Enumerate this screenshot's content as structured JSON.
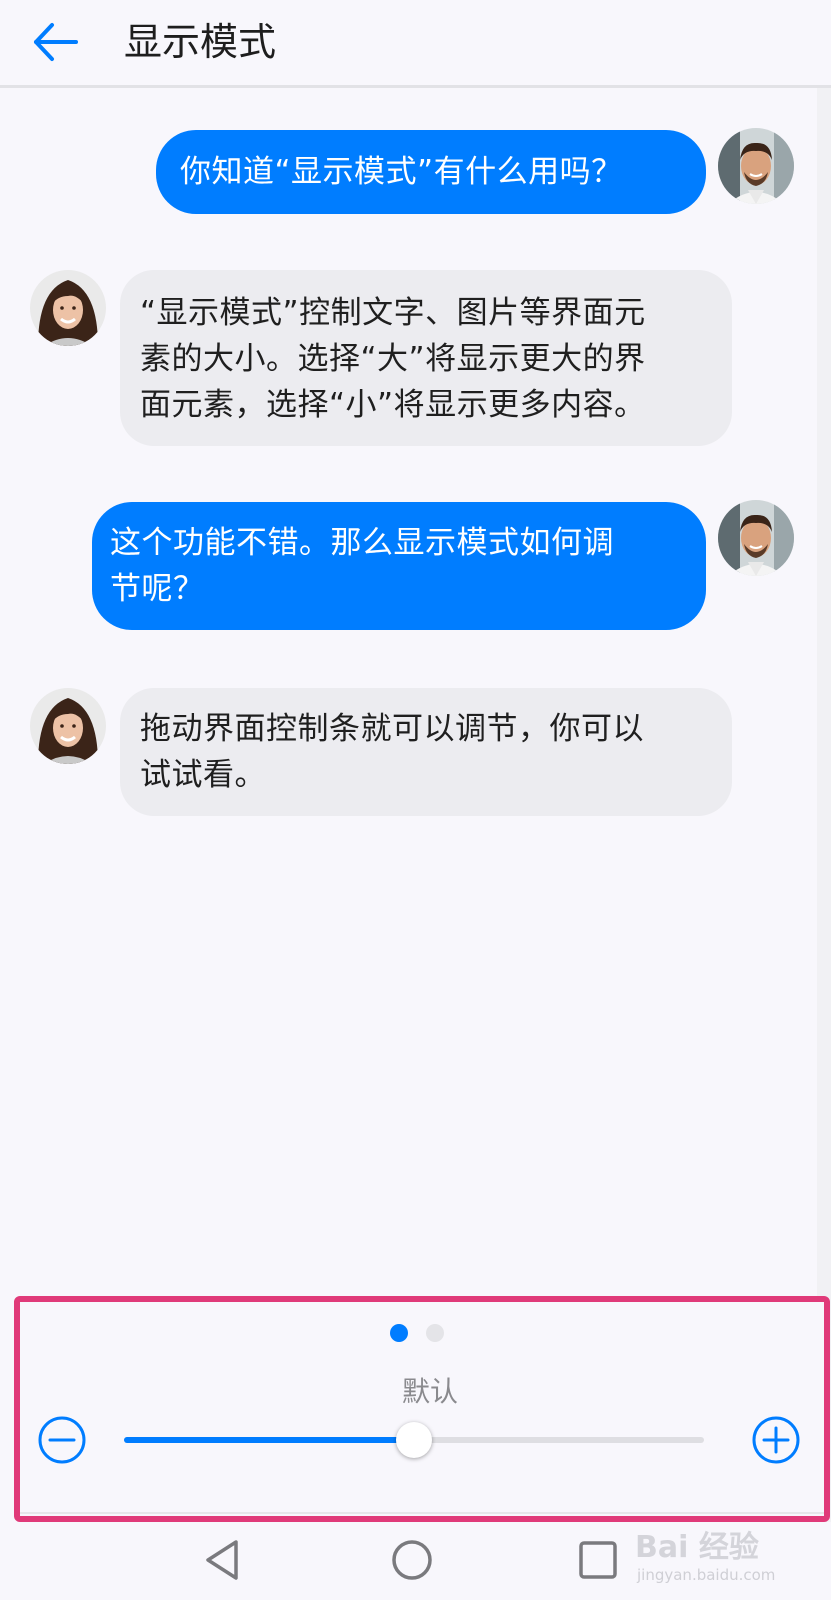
{
  "header": {
    "back_icon": "arrow-left-icon",
    "title": "显示模式"
  },
  "chat": {
    "messages": [
      {
        "side": "right",
        "avatar": "male-avatar",
        "text": "你知道“显示模式”有什么用吗？"
      },
      {
        "side": "left",
        "avatar": "female-avatar",
        "lines": [
          "“显示模式”控制文字、图片等界面元",
          "素的大小。选择“大”将显示更大的界",
          "面元素，选择“小”将显示更多内容。"
        ]
      },
      {
        "side": "right",
        "avatar": "male-avatar",
        "lines": [
          "这个功能不错。那么显示模式如何调",
          "节呢？"
        ]
      },
      {
        "side": "left",
        "avatar": "female-avatar",
        "lines": [
          "拖动界面控制条就可以调节，你可以",
          "试试看。"
        ]
      }
    ]
  },
  "control_panel": {
    "page_count": 2,
    "active_page": 1,
    "mode_label": "默认",
    "slider_value_fraction": 0.5,
    "minus_icon": "minus-circle-icon",
    "plus_icon": "plus-circle-icon"
  },
  "navbar": {
    "icons": [
      "triangle-back-icon",
      "circle-home-icon",
      "square-recent-icon"
    ]
  },
  "watermark": {
    "main": "Bai 经验",
    "sub": "jingyan.baidu.com"
  },
  "colors": {
    "accent": "#007dff",
    "highlight_border": "#e03a79",
    "incoming_bubble": "#ececf0",
    "background": "#f8f7fc"
  }
}
